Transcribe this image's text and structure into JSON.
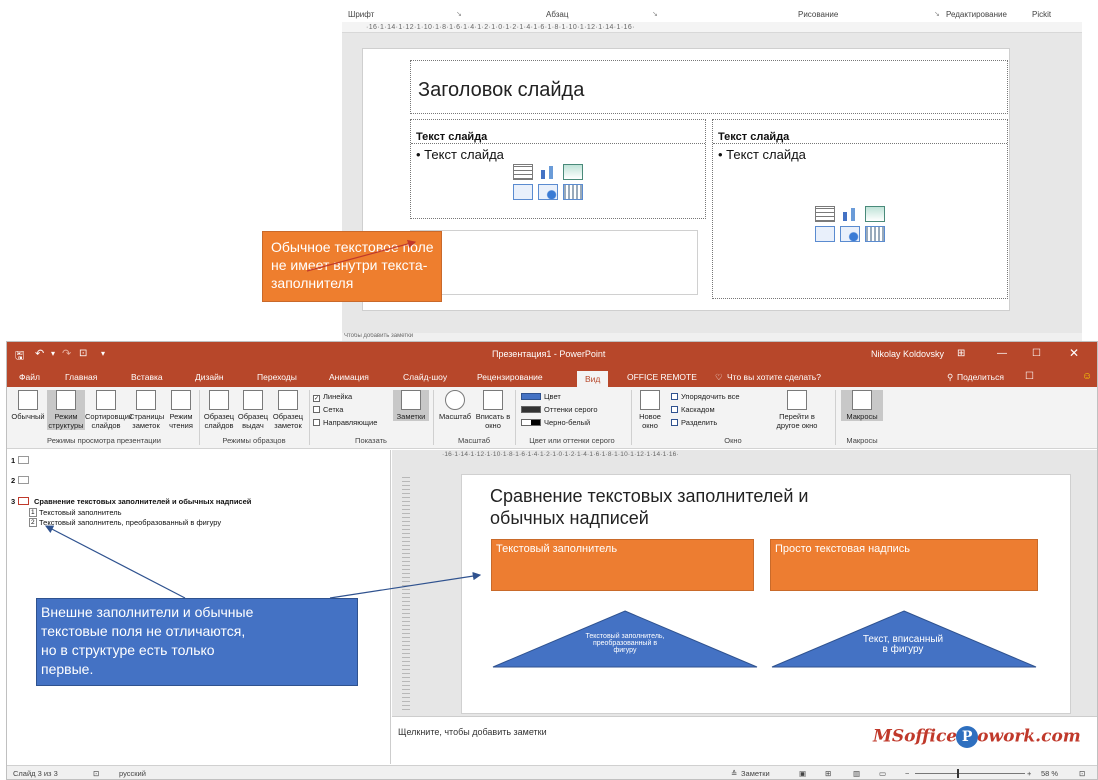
{
  "top_screen": {
    "ribbon_groups": [
      "Шрифт",
      "Абзац",
      "Рисование",
      "Редактирование",
      "Pickit"
    ],
    "ruler_text": "·16·1·14·1·12·1·10·1·8·1·6·1·4·1·2·1·0·1·2·1·4·1·6·1·8·1·10·1·12·1·14·1·16·",
    "slide_title_placeholder": "Заголовок слайда",
    "left_header": "Текст слайда",
    "left_body": "• Текст слайда",
    "right_header": "Текст слайда",
    "right_body": "• Текст слайда",
    "notes_partial": "Чтобы добавить заметки"
  },
  "callout_top": {
    "text_lines": [
      "Обычное текстовое поле",
      "не имеет внутри текста-",
      "заполнителя"
    ]
  },
  "powerpoint": {
    "title": "Презентация1 - PowerPoint",
    "user": "Nikolay Koldovsky",
    "tabs": [
      "Файл",
      "Главная",
      "Вставка",
      "Дизайн",
      "Переходы",
      "Анимация",
      "Слайд-шоу",
      "Рецензирование",
      "Вид",
      "OFFICE REMOTE"
    ],
    "active_tab": "Вид",
    "tell_me": "Что вы хотите сделать?",
    "share": "Поделиться",
    "ribbon": {
      "view_buttons": [
        "Обычный",
        "Режим структуры",
        "Сортировщик слайдов",
        "Страницы заметок",
        "Режим чтения"
      ],
      "master_buttons": [
        "Образец слайдов",
        "Образец выдач",
        "Образец заметок"
      ],
      "show_checks": [
        "Линейка",
        "Сетка",
        "Направляющие"
      ],
      "notes_button": "Заметки",
      "zoom_buttons": [
        "Масштаб",
        "Вписать в окно"
      ],
      "color_items": [
        "Цвет",
        "Оттенки серого",
        "Черно-белый"
      ],
      "window_items": [
        "Новое окно",
        "Упорядочить все",
        "Каскадом",
        "Разделить"
      ],
      "switch_window": "Перейти в другое окно",
      "macros": "Макросы",
      "groups": [
        "Режимы просмотра презентации",
        "Режимы образцов",
        "Показать",
        "Масштаб",
        "Цвет или оттенки серого",
        "Окно",
        "Макросы"
      ]
    },
    "outline": {
      "slide1_num": "1",
      "slide2_num": "2",
      "slide3_num": "3",
      "slide3_title": "Сравнение текстовых заполнителей и обычных надписей",
      "item1_num": "1",
      "item1": "Текстовый заполнитель",
      "item2_num": "2",
      "item2": "Текстовый заполнитель, преобразованный в фигуру"
    },
    "ruler_text": "·16·1·14·1·12·1·10·1·8·1·6·1·4·1·2·1·0·1·2·1·4·1·6·1·8·1·10·1·12·1·14·1·16·",
    "slide": {
      "title_line1": "Сравнение текстовых заполнителей и",
      "title_line2": "обычных надписей",
      "box_left": "Текстовый заполнитель",
      "box_right": "Просто текстовая надпись",
      "tri_left_line1": "Текстовый заполнитель,",
      "tri_left_line2": "преобразованный в",
      "tri_left_line3": "фигуру",
      "tri_right_line1": "Текст, вписанный",
      "tri_right_line2": "в фигуру"
    },
    "notes_placeholder": "Щелкните, чтобы добавить заметки",
    "watermark": {
      "left": "MSoffice",
      "p": "P",
      "right": "owork.com"
    },
    "status": {
      "slide_counter": "Слайд 3 из 3",
      "language": "русский",
      "notes": "Заметки",
      "zoom": "58 %"
    }
  },
  "callout_bottom": {
    "text_lines": [
      "Внешне заполнители и обычные",
      "текстовые поля не отличаются,",
      "но в структуре есть только",
      "первые."
    ]
  },
  "colors": {
    "ppt_red": "#b7472a",
    "callout_orange": "#ee7e2e",
    "callout_blue": "#4472c4",
    "shape_orange": "#ed7d31",
    "shape_blue": "#4472c4"
  }
}
